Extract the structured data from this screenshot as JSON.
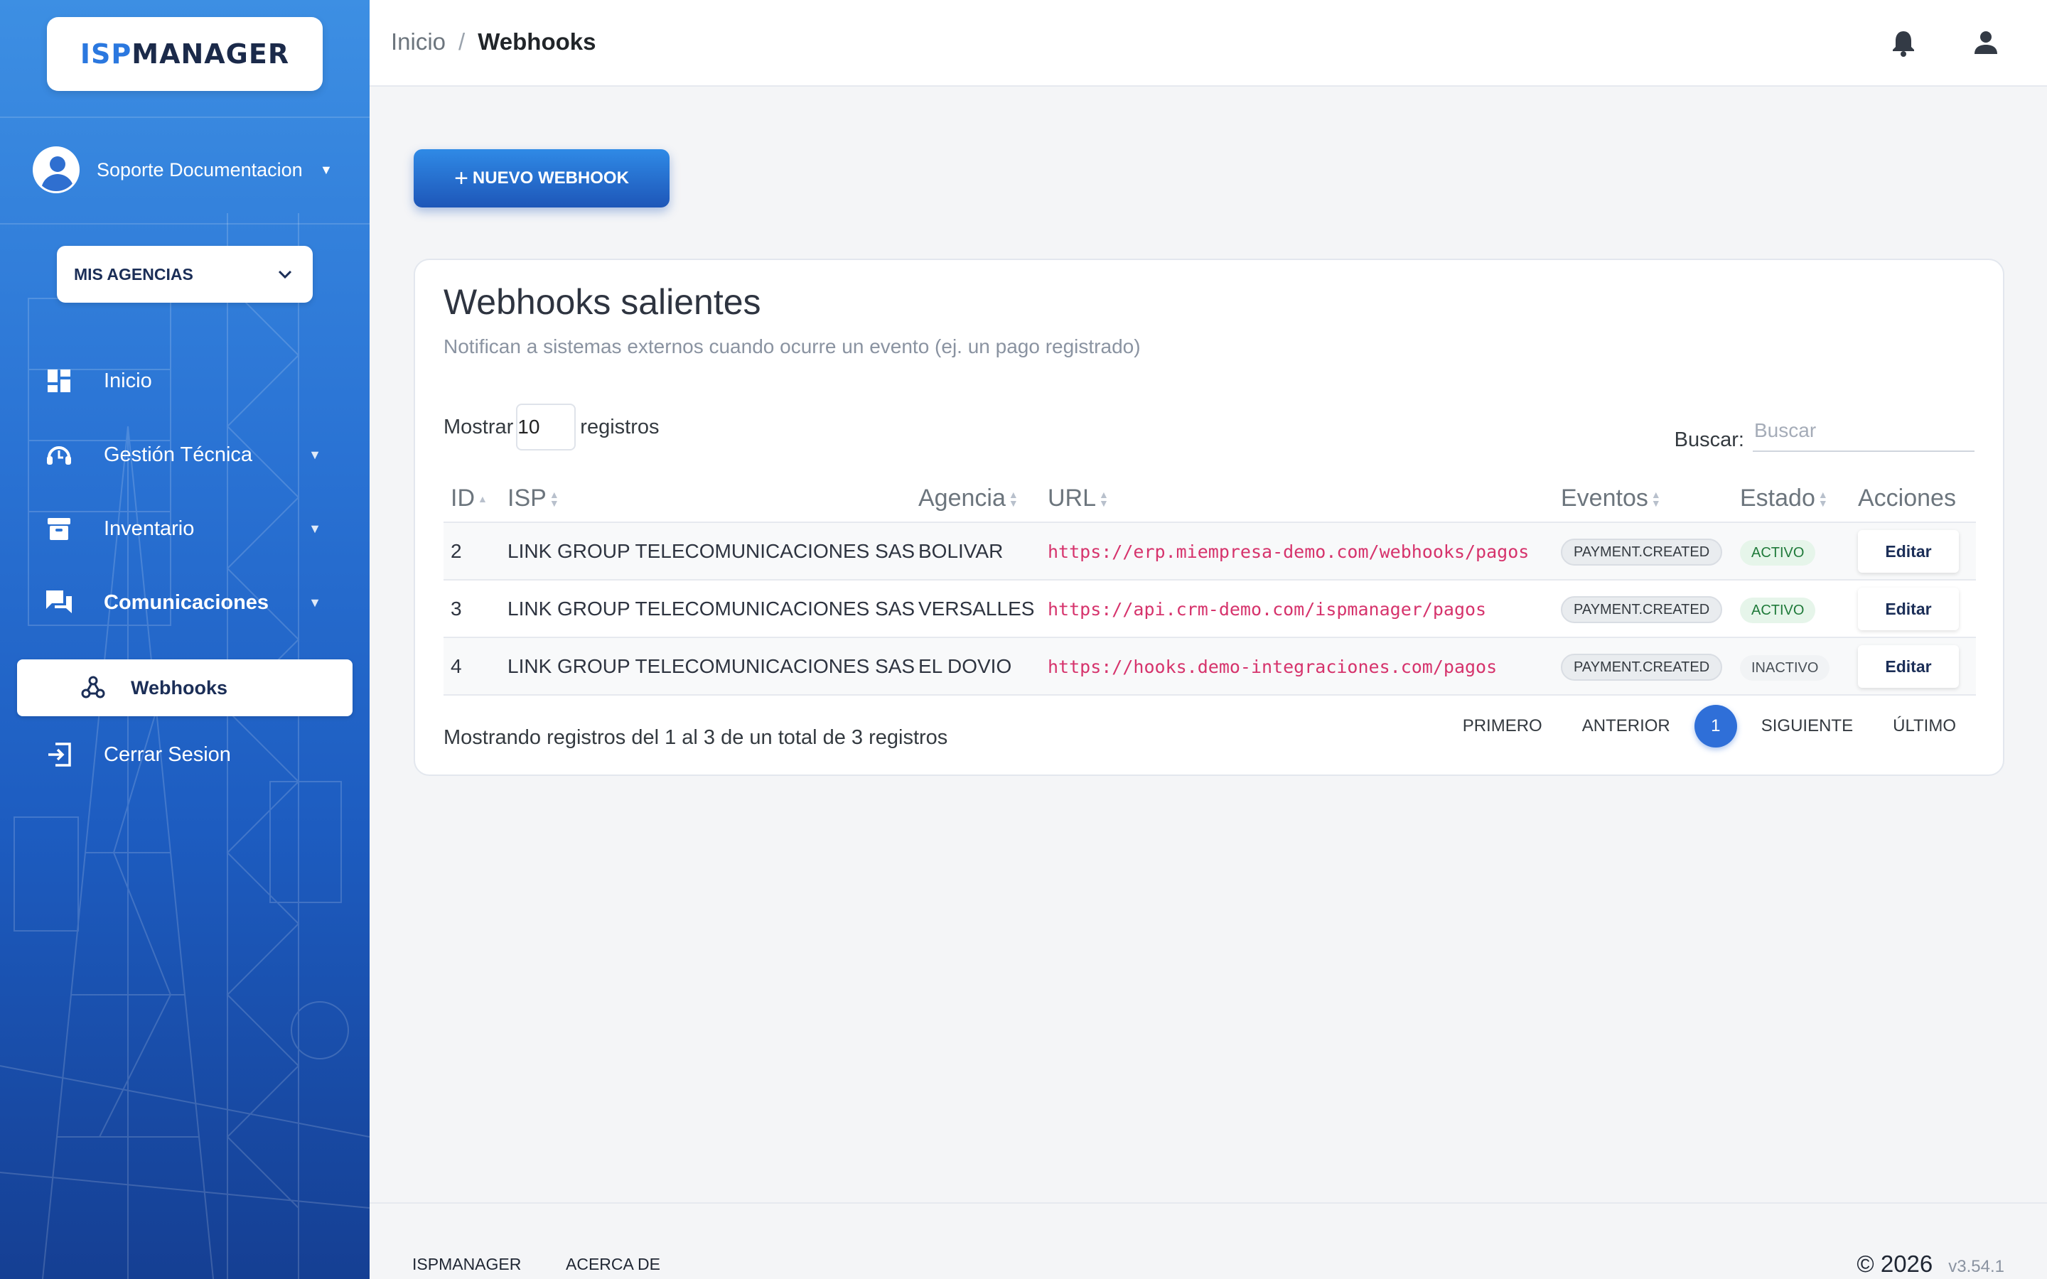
{
  "logo": {
    "part1": "ISP",
    "part2": "MANAGER"
  },
  "user": {
    "name": "Soporte Documentacion"
  },
  "agency_button": {
    "label": "MIS AGENCIAS"
  },
  "nav": {
    "inicio": "Inicio",
    "gestion": "Gestión Técnica",
    "inventario": "Inventario",
    "comunicaciones": "Comunicaciones",
    "webhooks": "Webhooks",
    "cerrar": "Cerrar Sesion"
  },
  "breadcrumb": {
    "home": "Inicio",
    "sep": "/",
    "current": "Webhooks"
  },
  "new_button": {
    "label": "NUEVO WEBHOOK"
  },
  "card": {
    "title": "Webhooks salientes",
    "subtitle": "Notifican a sistemas externos cuando ocurre un evento (ej. un pago registrado)"
  },
  "controls": {
    "show_prefix": "Mostrar",
    "show_value": "10",
    "show_suffix": "registros",
    "search_label": "Buscar:",
    "search_placeholder": "Buscar"
  },
  "table": {
    "headers": {
      "id": "ID",
      "isp": "ISP",
      "agencia": "Agencia",
      "url": "URL",
      "eventos": "Eventos",
      "estado": "Estado",
      "acciones": "Acciones"
    },
    "rows": [
      {
        "id": "2",
        "isp": "LINK GROUP TELECOMUNICACIONES SAS",
        "agencia": "BOLIVAR",
        "url": "https://erp.miempresa-demo.com/webhooks/pagos",
        "evento": "PAYMENT.CREATED",
        "estado": "ACTIVO",
        "accion": "Editar"
      },
      {
        "id": "3",
        "isp": "LINK GROUP TELECOMUNICACIONES SAS",
        "agencia": "VERSALLES",
        "url": "https://api.crm-demo.com/ispmanager/pagos",
        "evento": "PAYMENT.CREATED",
        "estado": "ACTIVO",
        "accion": "Editar"
      },
      {
        "id": "4",
        "isp": "LINK GROUP TELECOMUNICACIONES SAS",
        "agencia": "EL DOVIO",
        "url": "https://hooks.demo-integraciones.com/pagos",
        "evento": "PAYMENT.CREATED",
        "estado": "INACTIVO",
        "accion": "Editar"
      }
    ]
  },
  "info": "Mostrando registros del 1 al 3 de un total de 3 registros",
  "pager": {
    "first": "PRIMERO",
    "prev": "ANTERIOR",
    "current": "1",
    "next": "SIGUIENTE",
    "last": "ÚLTIMO"
  },
  "footer": {
    "link1": "ISPMANAGER",
    "link2": "ACERCA DE",
    "copyright": "© 2026",
    "version": "v3.54.1"
  },
  "colors": {
    "accent": "#2f6fd8",
    "sidebar_top": "#3d8fe3",
    "sidebar_bottom": "#153f93",
    "url": "#d6336c"
  }
}
